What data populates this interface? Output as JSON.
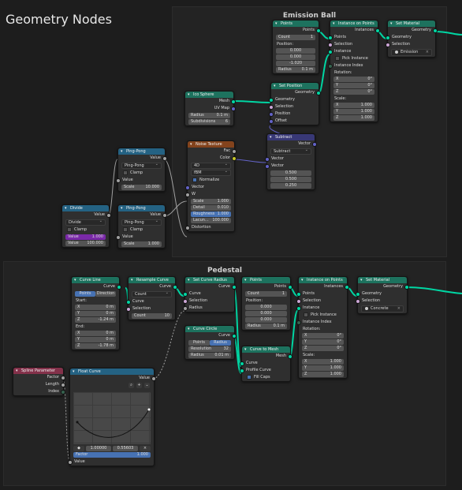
{
  "editor_title": "Geometry Nodes",
  "colors": {
    "geometry_header": "#1d725e",
    "texture_header": "#83431c",
    "converter_header": "#246283",
    "vector_header": "#383876",
    "input_header": "#83314a",
    "geometry_socket": "#00d6a3",
    "float_socket": "#a1a1a1",
    "vector_socket": "#6363c7",
    "selected_field": "#4772b3"
  },
  "frames": {
    "emission": "Emission Ball",
    "pedestal": "Pedestal"
  },
  "nodes": {
    "ico": {
      "title": "Ico Sphere",
      "out1": "Mesh",
      "out2": "UV Map",
      "radius_label": "Radius",
      "radius_value": "0.1 m",
      "subdiv_label": "Subdivisions",
      "subdiv_value": "6"
    },
    "points1": {
      "title": "Points",
      "out": "Points",
      "count_label": "Count",
      "count_value": "1",
      "position_label": "Position:",
      "pos": [
        "0.000",
        "0.000",
        "-1.020"
      ],
      "radius_label": "Radius",
      "radius_value": "0.1 m"
    },
    "setpos": {
      "title": "Set Position",
      "out": "Geometry",
      "in": [
        "Geometry",
        "Selection",
        "Position",
        "Offset"
      ]
    },
    "iop1": {
      "title": "Instance on Points",
      "out": "Instances",
      "in": [
        "Points",
        "Selection",
        "Instance"
      ],
      "pick": "Pick Instance",
      "index": "Instance Index",
      "rotation_label": "Rotation:",
      "rot": [
        [
          "X",
          "0°"
        ],
        [
          "Y",
          "0°"
        ],
        [
          "Z",
          "0°"
        ]
      ],
      "scale_label": "Scale:",
      "scale": [
        [
          "X",
          "1.000"
        ],
        [
          "Y",
          "1.000"
        ],
        [
          "Z",
          "1.000"
        ]
      ]
    },
    "setmat1": {
      "title": "Set Material",
      "out": "Geometry",
      "in": [
        "Geometry",
        "Selection"
      ],
      "material": "Emission"
    },
    "noise": {
      "title": "Noise Texture",
      "out1": "Fac",
      "out2": "Color",
      "dim": "4D",
      "basis": "fBM",
      "normalize": "Normalize",
      "in_vector": "Vector",
      "in_w": "W",
      "fields": [
        [
          "Scale",
          "1.000"
        ],
        [
          "Detail",
          "0.010"
        ],
        [
          "Roughness",
          "1.000"
        ],
        [
          "Lacun...",
          "100.000"
        ]
      ],
      "distortion": "Distortion"
    },
    "subtract": {
      "title": "Subtract",
      "out": "Vector",
      "op": "Subtract",
      "in1": "Vector",
      "in2": "Vector",
      "vals": [
        "0.500",
        "0.500",
        "0.250"
      ]
    },
    "pp1": {
      "title": "Ping-Pong",
      "out": "Value",
      "op": "Ping-Pong",
      "clamp": "Clamp",
      "in_value": "Value",
      "scale_label": "Scale",
      "scale_value": "10.000"
    },
    "pp2": {
      "title": "Ping-Pong",
      "out": "Value",
      "op": "Ping-Pong",
      "clamp": "Clamp",
      "in_value": "Value",
      "scale_label": "Scale",
      "scale_value": "1.000"
    },
    "divide": {
      "title": "Divide",
      "out": "Value",
      "op": "Divide",
      "clamp": "Clamp",
      "v1_label": "Value",
      "v1": "1.000",
      "v2_label": "Value",
      "v2": "100.000"
    },
    "curveline": {
      "title": "Curve Line",
      "out": "Curve",
      "tab1": "Points",
      "tab2": "Direction",
      "start": "Start:",
      "start_vals": [
        [
          "X",
          "0 m"
        ],
        [
          "Y",
          "0 m"
        ],
        [
          "Z",
          "-1.24 m"
        ]
      ],
      "end": "End:",
      "end_vals": [
        [
          "X",
          "0 m"
        ],
        [
          "Y",
          "0 m"
        ],
        [
          "Z",
          "-1.78 m"
        ]
      ]
    },
    "resample": {
      "title": "Resample Curve",
      "out": "Curve",
      "mode": "Count",
      "in": [
        "Curve",
        "Selection"
      ],
      "count_label": "Count",
      "count_value": "10"
    },
    "setradius": {
      "title": "Set Curve Radius",
      "out": "Curve",
      "in": [
        "Curve",
        "Selection",
        "Radius"
      ]
    },
    "points2": {
      "title": "Points",
      "out": "Points",
      "count_label": "Count",
      "count_value": "1",
      "position_label": "Position:",
      "pos": [
        "0.000",
        "0.000",
        "0.000"
      ],
      "radius_label": "Radius",
      "radius_value": "0.1 m"
    },
    "circle": {
      "title": "Curve Circle",
      "out": "Curve",
      "tab1": "Points",
      "tab2": "Radius",
      "res_label": "Resolution",
      "res_value": "32",
      "radius_label": "Radius",
      "radius_value": "0.01 m"
    },
    "c2m": {
      "title": "Curve to Mesh",
      "out": "Mesh",
      "in": [
        "Curve",
        "Profile Curve"
      ],
      "fill": "Fill Caps"
    },
    "iop2": {
      "title": "Instance on Points",
      "out": "Instances",
      "in": [
        "Points",
        "Selection",
        "Instance"
      ],
      "pick": "Pick Instance",
      "index": "Instance Index",
      "rotation_label": "Rotation:",
      "rot": [
        [
          "X",
          "0°"
        ],
        [
          "Y",
          "0°"
        ],
        [
          "Z",
          "0°"
        ]
      ],
      "scale_label": "Scale:",
      "scale": [
        [
          "X",
          "1.000"
        ],
        [
          "Y",
          "1.000"
        ],
        [
          "Z",
          "1.000"
        ]
      ]
    },
    "setmat2": {
      "title": "Set Material",
      "out": "Geometry",
      "in": [
        "Geometry",
        "Selection"
      ],
      "material": "Concrete"
    },
    "spline": {
      "title": "Spline Parameter",
      "out": [
        "Factor",
        "Length",
        "Index"
      ]
    },
    "floatcurve": {
      "title": "Float Curve",
      "out": "Value",
      "coord_x": "1.00000",
      "coord_y": "0.55603",
      "factor_label": "Factor",
      "factor_value": "1.000",
      "in_value": "Value",
      "zoom_icon": "zoom-icon",
      "add_icon": "plus-icon",
      "menu_icon": "chevron-down-icon"
    }
  }
}
